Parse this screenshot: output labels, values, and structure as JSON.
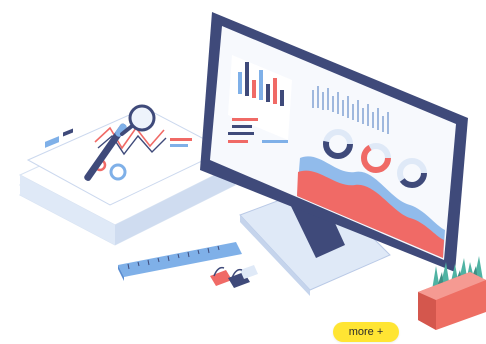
{
  "illustration": {
    "subject": "analytics-dashboard",
    "monitor_icon": "monitor-icon",
    "report_stack_icon": "report-stack-icon",
    "ruler_icon": "ruler-icon",
    "binder_clips_icon": "binder-clips-icon",
    "plant_pot_icon": "plant-pot-icon",
    "colors": {
      "navy": "#3f4a7a",
      "coral": "#f06a66",
      "light_blue": "#7fb0e8",
      "pale_blue": "#dfe9f7",
      "plant_green": "#4fb3a3",
      "pot_red": "#ee6e63"
    }
  },
  "cta": {
    "label": "more +",
    "color": "#ffe533"
  }
}
